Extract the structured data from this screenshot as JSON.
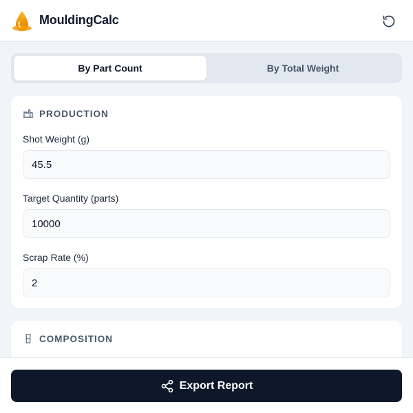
{
  "app": {
    "title": "MouldingCalc",
    "logo_icon": "droplet-logo-icon",
    "reset_icon": "reset-icon"
  },
  "tabs": [
    {
      "label": "By Part Count",
      "active": true
    },
    {
      "label": "By Total Weight",
      "active": false
    }
  ],
  "production": {
    "title": "PRODUCTION",
    "icon": "factory-icon",
    "fields": [
      {
        "label": "Shot Weight (g)",
        "value": "45.5"
      },
      {
        "label": "Target Quantity (parts)",
        "value": "10000"
      },
      {
        "label": "Scrap Rate (%)",
        "value": "2"
      }
    ]
  },
  "composition": {
    "title": "COMPOSITION",
    "icon": "beaker-icon"
  },
  "footer": {
    "export_label": "Export Report",
    "export_icon": "share-icon"
  },
  "colors": {
    "accent_dark": "#0f172a",
    "logo_orange": "#f59e0b",
    "background": "#f1f5f9"
  }
}
